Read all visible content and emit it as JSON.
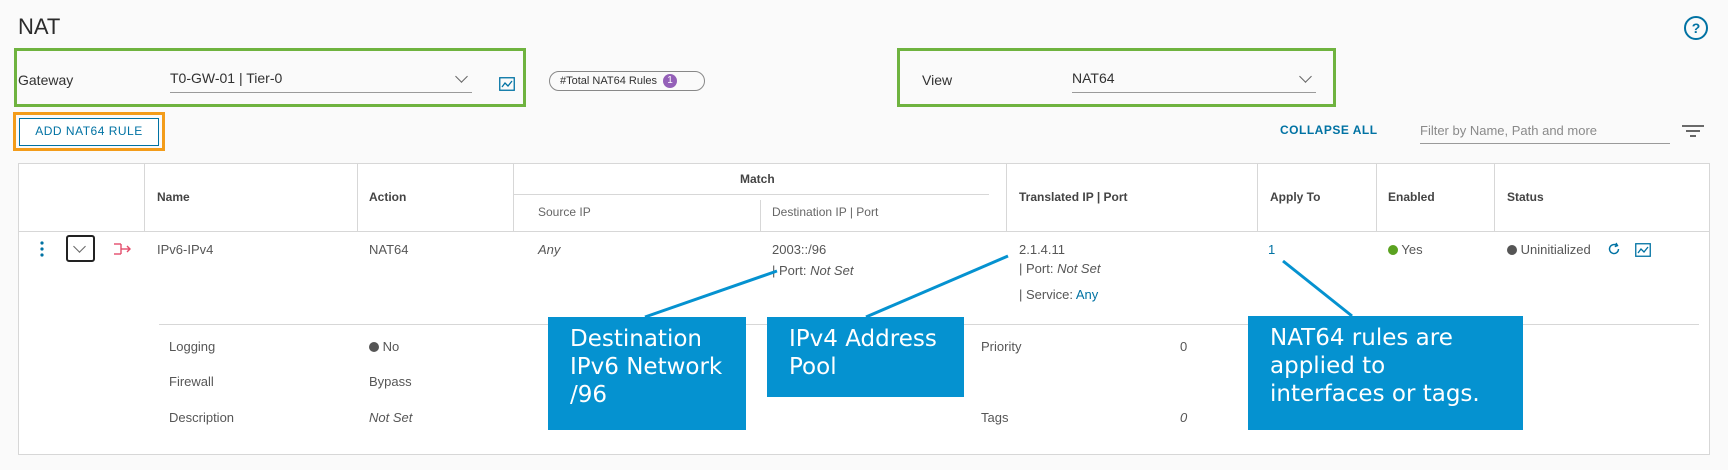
{
  "page": {
    "title": "NAT",
    "help_icon": "?"
  },
  "toolbar": {
    "gateway_label": "Gateway",
    "gateway_value": "T0-GW-01 | Tier-0",
    "total_pill": "#Total NAT64 Rules",
    "total_count": "1",
    "view_label": "View",
    "view_value": "NAT64",
    "add_button": "ADD NAT64 RULE",
    "collapse_all": "COLLAPSE ALL",
    "filter_placeholder": "Filter by Name, Path and more"
  },
  "table": {
    "headers": {
      "name": "Name",
      "action": "Action",
      "match": "Match",
      "source_ip": "Source IP",
      "dest_ip": "Destination IP | Port",
      "translated": "Translated IP | Port",
      "apply_to": "Apply To",
      "enabled": "Enabled",
      "status": "Status"
    },
    "row": {
      "name": "IPv6-IPv4",
      "action": "NAT64",
      "source": "Any",
      "dest_ip": "2003::/96",
      "dest_port_label": "| Port:",
      "dest_port_value": "Not Set",
      "trans_ip": "2.1.4.11",
      "trans_port_label": "| Port:",
      "trans_port_value": "Not Set",
      "trans_service_label": "| Service:",
      "trans_service_value": "Any",
      "apply_to": "1",
      "enabled": "Yes",
      "status": "Uninitialized"
    },
    "details": {
      "logging_label": "Logging",
      "logging_value": "No",
      "firewall_label": "Firewall",
      "firewall_value": "Bypass",
      "description_label": "Description",
      "description_value": "Not Set",
      "priority_label": "Priority",
      "priority_value": "0",
      "tags_label": "Tags",
      "tags_value": "0"
    }
  },
  "callouts": {
    "dest": [
      "Destination",
      "IPv6 Network",
      "/96"
    ],
    "ipv4": [
      "IPv4 Address",
      "Pool"
    ],
    "rules": [
      "NAT64 rules are",
      "applied to",
      "interfaces or tags."
    ]
  },
  "colors": {
    "highlight_green": "#6fb33f",
    "highlight_orange": "#f39c1a",
    "accent_blue": "#0072a3",
    "callout_blue": "#0592d0",
    "enabled_green": "#5aa220",
    "rule_icon_red": "#e34d6b"
  }
}
